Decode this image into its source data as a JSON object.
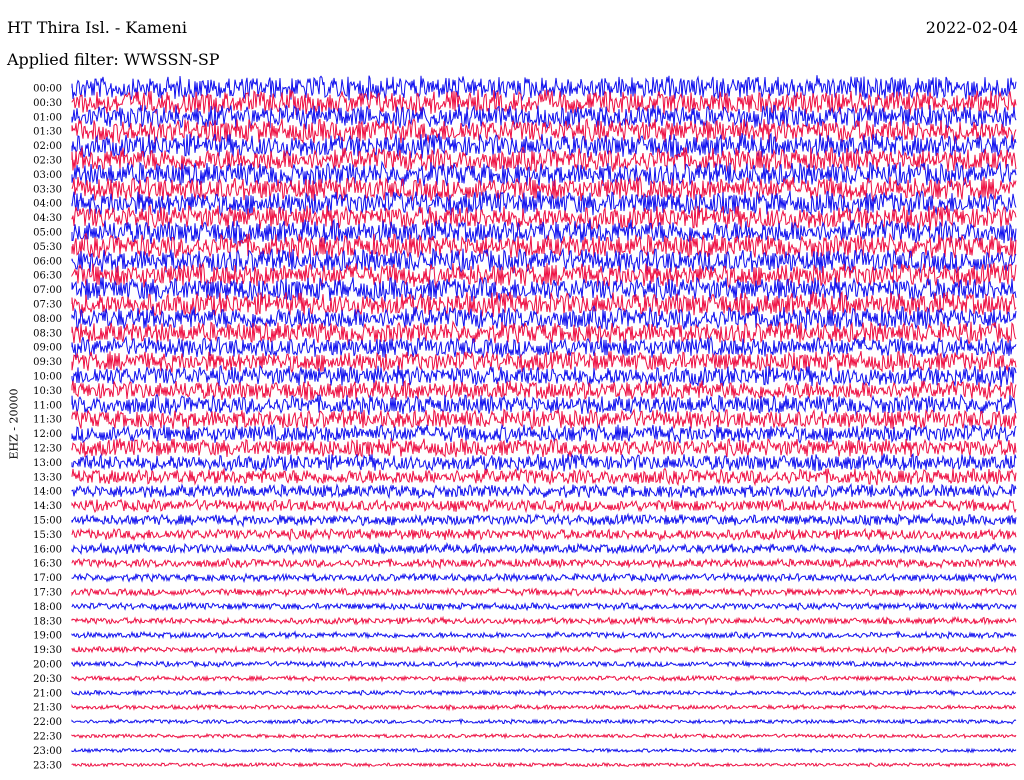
{
  "header": {
    "station": "HT Thira Isl. - Kameni",
    "date": "2022-02-04",
    "filter": "Applied filter: WWSSN-SP"
  },
  "chart_data": {
    "type": "line",
    "title": "HT Thira Isl. - Kameni",
    "date": "2022-02-04",
    "ylabel": "EHZ - 20000",
    "colors": [
      "#ee1144",
      "#1111ee"
    ],
    "row_labels": [
      "00:00",
      "00:30",
      "01:00",
      "01:30",
      "02:00",
      "02:30",
      "03:00",
      "03:30",
      "04:00",
      "04:30",
      "05:00",
      "05:30",
      "06:00",
      "06:30",
      "07:00",
      "07:30",
      "08:00",
      "08:30",
      "09:00",
      "09:30",
      "10:00",
      "10:30",
      "11:00",
      "11:30",
      "12:00",
      "12:30",
      "13:00",
      "13:30",
      "14:00",
      "14:30",
      "15:00",
      "15:30",
      "16:00",
      "16:30",
      "17:00",
      "17:30",
      "18:00",
      "18:30",
      "19:00",
      "19:30",
      "20:00",
      "20:30",
      "21:00",
      "21:30",
      "22:00",
      "22:30",
      "23:00",
      "23:30"
    ],
    "row_noise_amplitude": [
      1,
      1,
      1,
      1,
      1,
      1,
      1,
      1,
      1,
      1,
      1,
      1,
      1,
      1,
      1,
      1,
      0.95,
      0.9,
      0.85,
      0.85,
      0.85,
      0.8,
      0.8,
      0.8,
      0.75,
      0.75,
      0.7,
      0.65,
      0.55,
      0.5,
      0.45,
      0.45,
      0.4,
      0.35,
      0.32,
      0.3,
      0.28,
      0.27,
      0.25,
      0.24,
      0.22,
      0.2,
      0.19,
      0.18,
      0.17,
      0.16,
      0.15,
      0.15
    ]
  }
}
